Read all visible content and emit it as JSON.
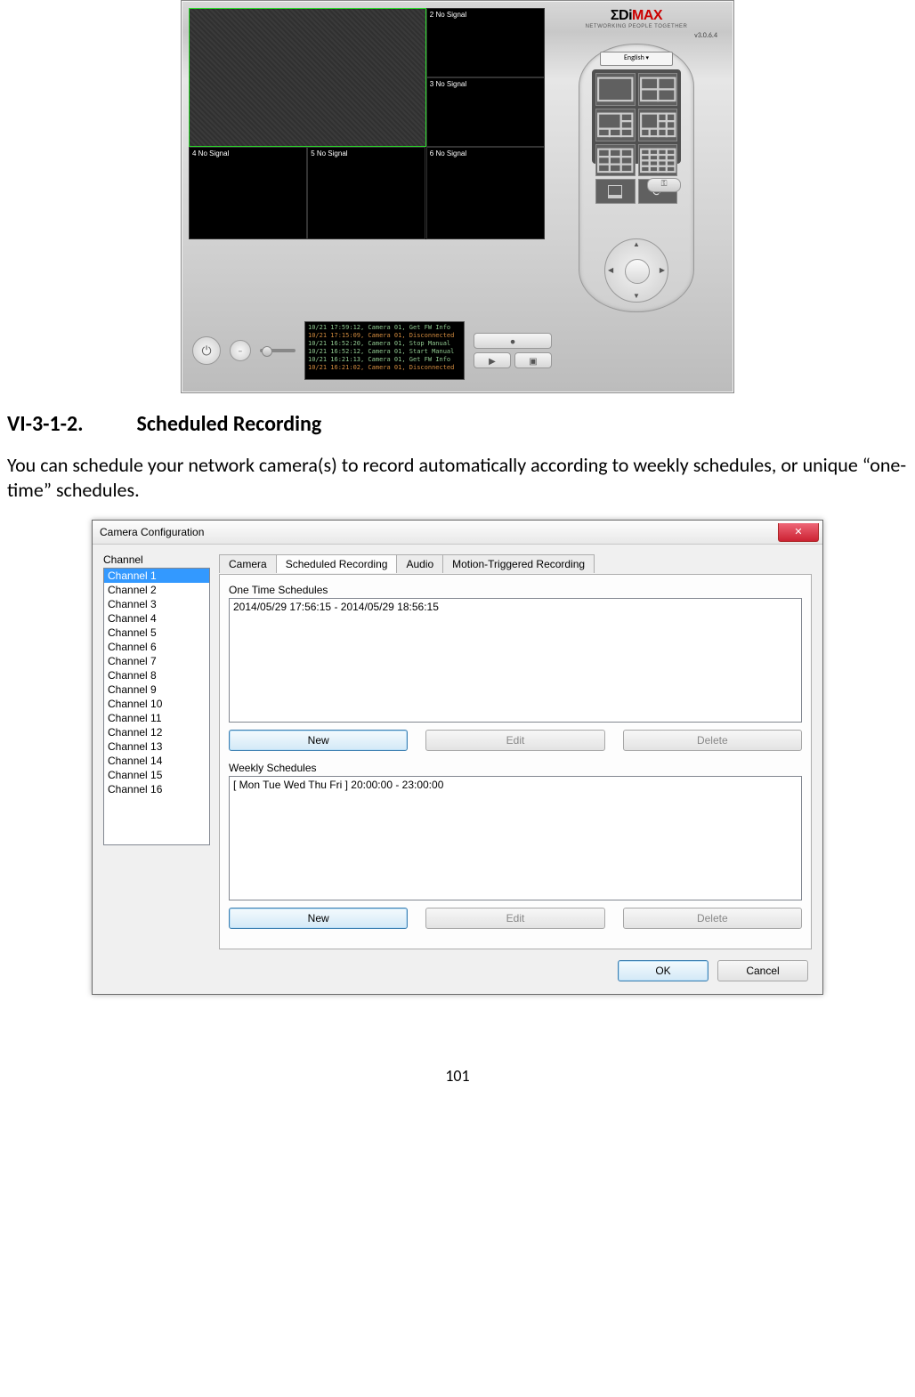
{
  "viewer": {
    "cells": {
      "c2": "2 No Signal",
      "c3": "3 No Signal",
      "c4": "4 No Signal",
      "c5": "5 No Signal",
      "c6": "6 No Signal"
    },
    "brand_name_a": "ΣDi",
    "brand_name_b": "MAX",
    "brand_tag": "NETWORKING PEOPLE TOGETHER",
    "version": "v3.0.6.4",
    "language": "English",
    "log": [
      "10/21 17:59:12, Camera 01, Get FW Info",
      "10/21 17:15:09, Camera 01, Disconnected",
      "10/21 16:52:20, Camera 01, Stop Manual",
      "10/21 16:52:12, Camera 01, Start Manual",
      "10/21 16:21:13, Camera 01, Get FW Info",
      "10/21 16:21:02, Camera 01, Disconnected"
    ]
  },
  "doc": {
    "section_no": "VI-3-1-2.",
    "section_title": "Scheduled Recording",
    "paragraph": "You can schedule your network camera(s) to record automatically according to weekly schedules, or unique “one-time” schedules."
  },
  "dialog": {
    "title": "Camera Configuration",
    "channel_label": "Channel",
    "channels": [
      "Channel 1",
      "Channel 2",
      "Channel 3",
      "Channel 4",
      "Channel 5",
      "Channel 6",
      "Channel 7",
      "Channel 8",
      "Channel 9",
      "Channel 10",
      "Channel 11",
      "Channel 12",
      "Channel 13",
      "Channel 14",
      "Channel 15",
      "Channel 16"
    ],
    "tabs": [
      "Camera",
      "Scheduled Recording",
      "Audio",
      "Motion-Triggered Recording"
    ],
    "active_tab": "Scheduled Recording",
    "one_time_label": "One Time Schedules",
    "one_time_entry": "2014/05/29 17:56:15 - 2014/05/29 18:56:15",
    "weekly_label": "Weekly Schedules",
    "weekly_entry": "[ Mon Tue Wed Thu Fri ] 20:00:00 - 23:00:00",
    "btn_new": "New",
    "btn_edit": "Edit",
    "btn_delete": "Delete",
    "btn_ok": "OK",
    "btn_cancel": "Cancel"
  },
  "page_number": "101"
}
